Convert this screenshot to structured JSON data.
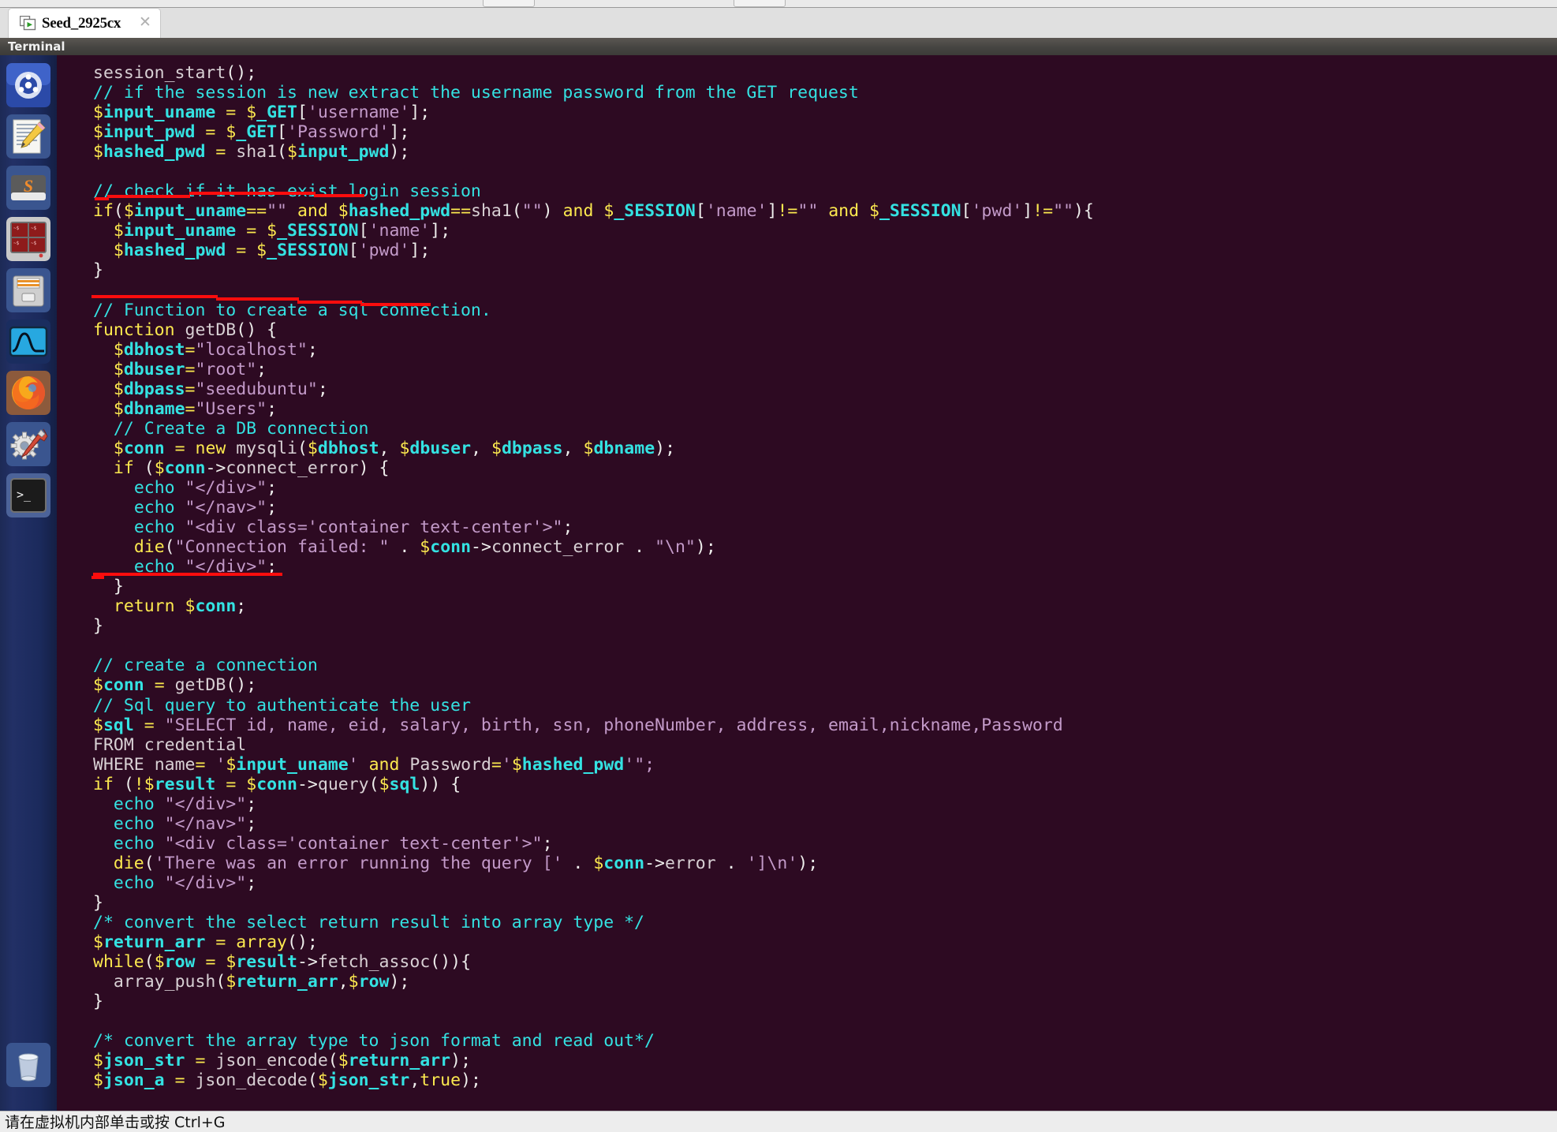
{
  "window": {
    "tab": {
      "title": "Seed_2925cx",
      "icon": "vm-window-icon",
      "close_icon": "close-icon",
      "close_label": "✕"
    },
    "toolbar_buttons": [
      "toolbar-button-1",
      "toolbar-button-2"
    ]
  },
  "guest": {
    "panel_title": "Terminal",
    "launcher": {
      "items": [
        {
          "name": "ubuntu-dash",
          "label": "Ubuntu Dash Home"
        },
        {
          "name": "text-editor",
          "label": "Text Editor"
        },
        {
          "name": "sublime-text",
          "label": "Sublime Text"
        },
        {
          "name": "terminal-grid",
          "label": "Terminal Multiplexer"
        },
        {
          "name": "file-manager",
          "label": "Files"
        },
        {
          "name": "wireshark",
          "label": "Wireshark"
        },
        {
          "name": "firefox",
          "label": "Firefox Web Browser"
        },
        {
          "name": "system-settings",
          "label": "System Settings"
        },
        {
          "name": "terminal",
          "label": "Terminal"
        }
      ],
      "trash": {
        "name": "trash",
        "label": "Trash"
      }
    }
  },
  "terminal": {
    "language": "php",
    "cursor_visible": true,
    "annotations": [
      {
        "name": "underline-check-exist-login-session",
        "target_line": 7,
        "color": "#fb0d0d"
      },
      {
        "name": "underline-function-to-create-sql-connection",
        "target_line": 13,
        "color": "#fb0d0d"
      },
      {
        "name": "underline-create-a-connection",
        "target_line": 32,
        "color": "#fb0d0d"
      }
    ],
    "code_lines": [
      "session_start();",
      "// if the session is new extract the username password from the GET request",
      "$input_uname = $_GET['username'];",
      "$input_pwd = $_GET['Password'];",
      "$hashed_pwd = sha1($input_pwd);",
      "",
      "// check if it has exist login session",
      "if($input_uname==\"\" and $hashed_pwd==sha1(\"\") and $_SESSION['name']!=\"\" and $_SESSION['pwd']!=\"\"){",
      "  $input_uname = $_SESSION['name'];",
      "  $hashed_pwd = $_SESSION['pwd'];",
      "}",
      "",
      "// Function to create a sql connection.",
      "function getDB() {",
      "  $dbhost=\"localhost\";",
      "  $dbuser=\"root\";",
      "  $dbpass=\"seedubuntu\";",
      "  $dbname=\"Users\";",
      "  // Create a DB connection",
      "  $conn = new mysqli($dbhost, $dbuser, $dbpass, $dbname);",
      "  if ($conn->connect_error) {",
      "    echo \"</div>\";",
      "    echo \"</nav>\";",
      "    echo \"<div class='container text-center'>\";",
      "    die(\"Connection failed: \" . $conn->connect_error . \"\\n\");",
      "    echo \"</div>\";",
      "  }",
      "  return $conn;",
      "}",
      "",
      "// create a connection",
      "$conn = getDB();",
      "// Sql query to authenticate the user",
      "$sql = \"SELECT id, name, eid, salary, birth, ssn, phoneNumber, address, email,nickname,Password",
      "FROM credential",
      "WHERE name= '$input_uname' and Password='$hashed_pwd'\";",
      "if (!$result = $conn->query($sql)) {",
      "  echo \"</div>\";",
      "  echo \"</nav>\";",
      "  echo \"<div class='container text-center'>\";",
      "  die('There was an error running the query [' . $conn->error . ']\\n');",
      "  echo \"</div>\";",
      "}",
      "/* convert the select return result into array type */",
      "$return_arr = array();",
      "while($row = $result->fetch_assoc()){",
      "  array_push($return_arr,$row);",
      "}",
      "",
      "/* convert the array type to json format and read out*/",
      "$json_str = json_encode($return_arr);",
      "$json_a = json_decode($json_str,true);"
    ]
  },
  "status_bar": {
    "text": "请在虚拟机内部单击或按 Ctrl+G"
  },
  "colors": {
    "terminal_bg": "#2d0a22",
    "comment": "#34e2e2",
    "variable": "#34e2e2",
    "sigil": "#fce94f",
    "keyword": "#fce94f",
    "string": "#c39ac9",
    "plain": "#d8d0d4",
    "annotation_red": "#fb0d0d",
    "launcher_bg": "#22306b",
    "panel_bg": "#454441"
  }
}
